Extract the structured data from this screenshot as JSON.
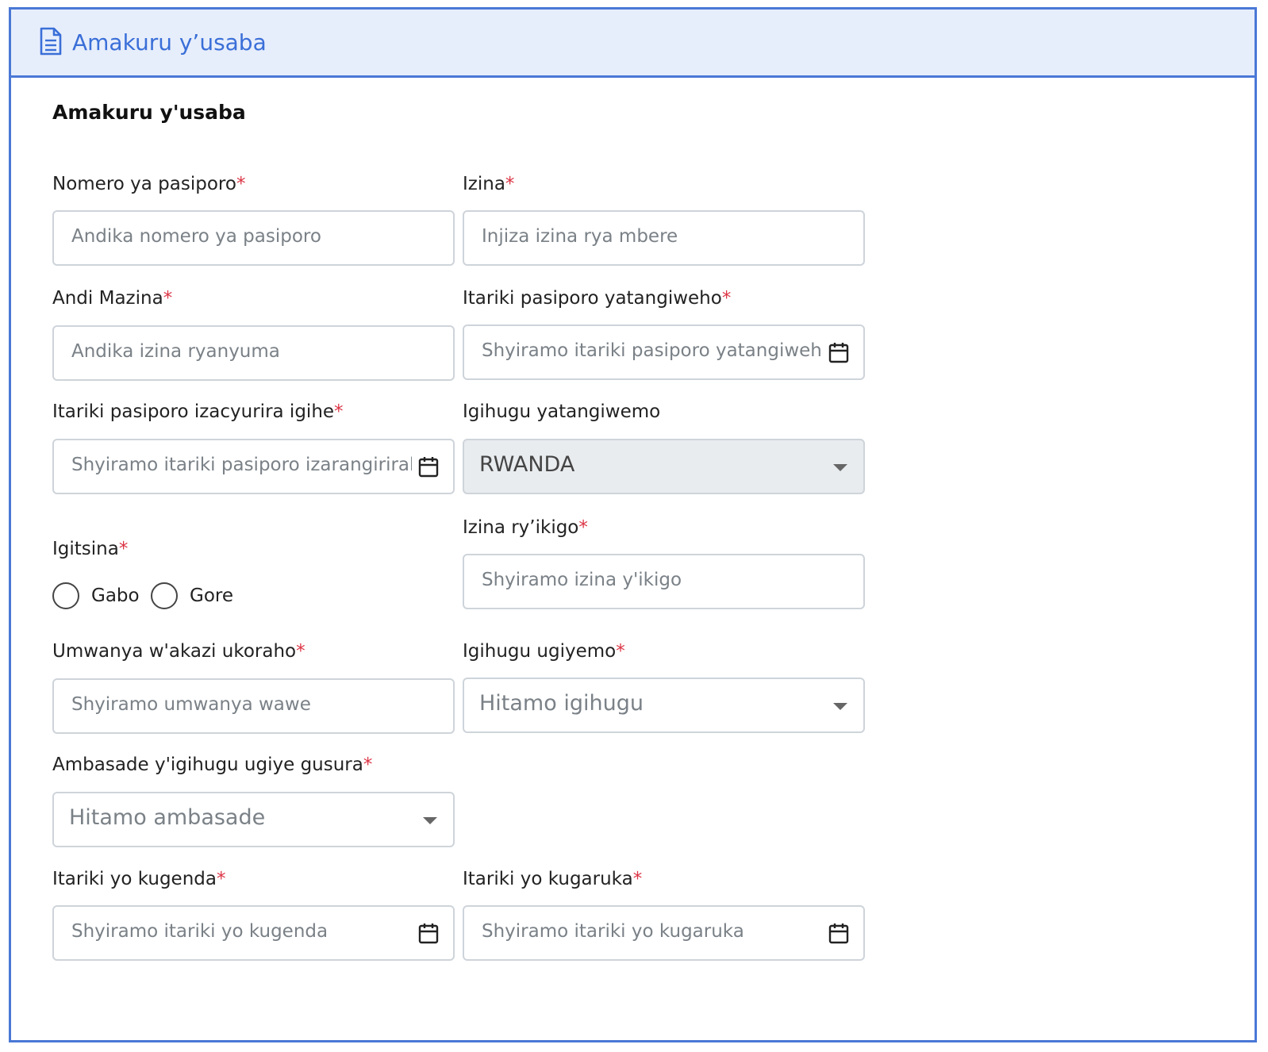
{
  "header": {
    "title": "Amakuru y’usaba",
    "icon": "document-icon"
  },
  "section": {
    "title": "Amakuru y'usaba"
  },
  "fields": {
    "passport_number": {
      "label": "Nomero ya pasiporo",
      "placeholder": "Andika nomero ya pasiporo"
    },
    "first_name": {
      "label": "Izina",
      "placeholder": "Injiza izina rya mbere"
    },
    "last_name": {
      "label": "Andi Mazina",
      "placeholder": "Andika izina ryanyuma"
    },
    "issue_date": {
      "label": "Itariki pasiporo yatangiweho",
      "placeholder": "Shyiramo itariki pasiporo yatangiweho"
    },
    "expiry_date": {
      "label": "Itariki pasiporo izacyurira igihe",
      "placeholder": "Shyiramo itariki pasiporo izarangirirahc"
    },
    "issuing_country": {
      "label": "Igihugu yatangiwemo",
      "value": "RWANDA"
    },
    "gender": {
      "label": "Igitsina",
      "options": [
        "Gabo",
        "Gore"
      ]
    },
    "company_name": {
      "label": "Izina ry’ikigo",
      "placeholder": "Shyiramo izina y'ikigo"
    },
    "occupation": {
      "label": "Umwanya w'akazi ukoraho",
      "placeholder": "Shyiramo umwanya wawe"
    },
    "destination_country": {
      "label": "Igihugu ugiyemo",
      "placeholder": "Hitamo igihugu"
    },
    "embassy": {
      "label": "Ambasade y'igihugu ugiye gusura",
      "placeholder": "Hitamo ambasade"
    },
    "departure_date": {
      "label": "Itariki yo kugenda",
      "placeholder": "Shyiramo itariki yo kugenda"
    },
    "return_date": {
      "label": "Itariki yo kugaruka",
      "placeholder": "Shyiramo itariki yo kugaruka"
    }
  },
  "required_marker": "*",
  "colors": {
    "accent": "#4a78d6",
    "header_bg": "#e7eefb",
    "required": "#dc3545",
    "disabled_bg": "#e9ecef"
  }
}
